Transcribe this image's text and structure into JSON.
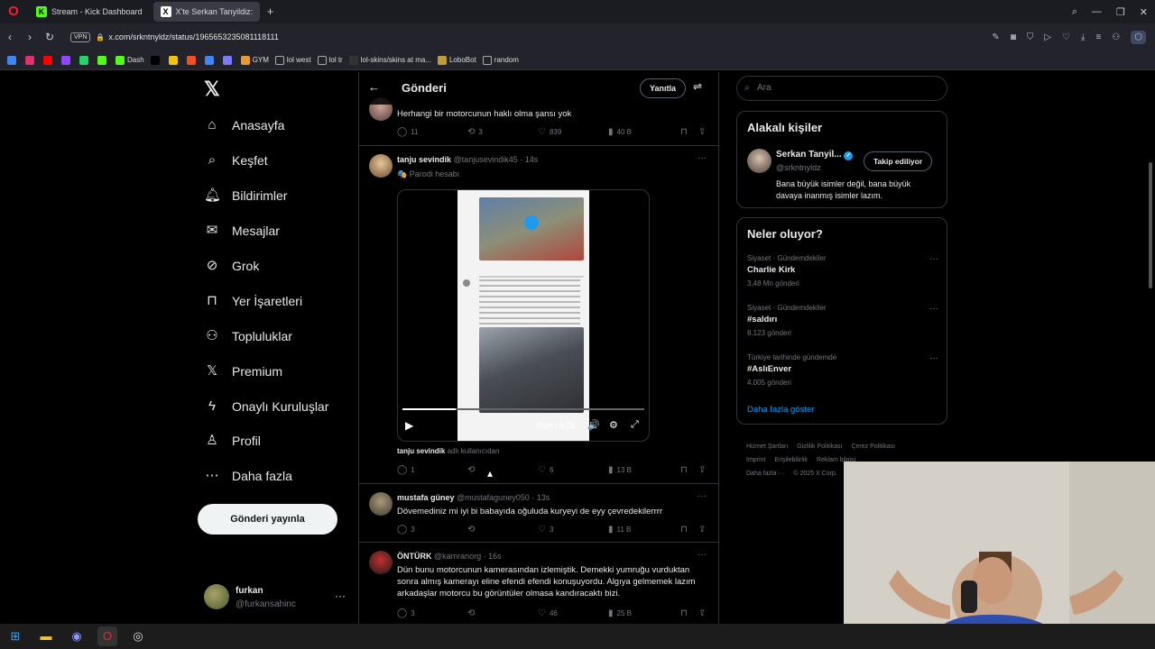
{
  "browser": {
    "tabs": [
      {
        "label": "Stream - Kick Dashboard",
        "active": false
      },
      {
        "label": "X'te Serkan Tanyildiz:",
        "active": true
      }
    ],
    "url": "x.com/srkntnyldz/status/1965653235081118111",
    "vpn_label": "VPN",
    "bookmarks": [
      {
        "label": "",
        "icon": "chrome"
      },
      {
        "label": "",
        "icon": "instagram"
      },
      {
        "label": "",
        "icon": "youtube"
      },
      {
        "label": "",
        "icon": "twitch"
      },
      {
        "label": "",
        "icon": "whatsapp"
      },
      {
        "label": "",
        "icon": "kick"
      },
      {
        "label": "Dash",
        "icon": "kick"
      },
      {
        "label": "",
        "icon": "x"
      },
      {
        "label": "",
        "icon": "s"
      },
      {
        "label": "",
        "icon": "microsoft"
      },
      {
        "label": "",
        "icon": "chrome"
      },
      {
        "label": "",
        "icon": "news"
      },
      {
        "label": "GYM",
        "icon": "gym"
      },
      {
        "label": "lol west",
        "icon": "folder"
      },
      {
        "label": "lol tr",
        "icon": "folder"
      },
      {
        "label": "lol-skins/skins at ma...",
        "icon": "github"
      },
      {
        "label": "LoboBot",
        "icon": "lobo"
      },
      {
        "label": "random",
        "icon": "folder"
      }
    ]
  },
  "nav": {
    "items": [
      {
        "label": "Anasayfa",
        "icon": "home"
      },
      {
        "label": "Keşfet",
        "icon": "search"
      },
      {
        "label": "Bildirimler",
        "icon": "bell"
      },
      {
        "label": "Mesajlar",
        "icon": "mail"
      },
      {
        "label": "Grok",
        "icon": "grok"
      },
      {
        "label": "Yer İşaretleri",
        "icon": "bookmark"
      },
      {
        "label": "Topluluklar",
        "icon": "communities"
      },
      {
        "label": "Premium",
        "icon": "x"
      },
      {
        "label": "Onaylı Kuruluşlar",
        "icon": "bolt"
      },
      {
        "label": "Profil",
        "icon": "person"
      },
      {
        "label": "Daha fazla",
        "icon": "more"
      }
    ],
    "post_button": "Gönderi yayınla",
    "account": {
      "name": "furkan",
      "handle": "@furkansahinc"
    }
  },
  "center": {
    "title": "Gönderi",
    "reply_button": "Yanıtla",
    "tweets": [
      {
        "text": "Herhangi bir motorcunun haklı olma şansı yok",
        "replies": "11",
        "retweets": "3",
        "likes": "839",
        "views": "40 B"
      },
      {
        "name": "tanju sevindik",
        "handle": "@tanjusevindik45 · 14s",
        "parody": "Parodi hesabı",
        "video_time": "0:06 / 0:28",
        "video_progress": 0.22,
        "caption_user": "tanju sevindik",
        "caption_rest": "adlı kullanıcıdan",
        "replies": "1",
        "retweets": "",
        "likes": "6",
        "views": "13 B"
      },
      {
        "name": "mustafa güney",
        "handle": "@mustafaguney050 · 13s",
        "text": "Dövemediniz mi iyi bi babayıda oğuluda kuryeyi de eyy çevredekilerrrr",
        "replies": "3",
        "retweets": "",
        "likes": "3",
        "views": "11 B"
      },
      {
        "name": "ÖNTÜRK",
        "handle": "@kamranorg · 16s",
        "text": "Dün bunu motorcunun kamerasından izlemiştik. Demekki yumruğu vurduktan sonra almış kamerayı eline efendi efendi konuşuyordu. Algıya gelmemek lazım arkadaşlar motorcu bu görüntüler olmasa kandıracaktı bizi.",
        "replies": "3",
        "retweets": "",
        "likes": "46",
        "views": "25 B"
      }
    ]
  },
  "right": {
    "search_placeholder": "Ara",
    "related": {
      "title": "Alakalı kişiler",
      "name": "Serkan Tanyil...",
      "handle": "@srkntnyldz",
      "follow_button": "Takip ediliyor",
      "bio": "Bana büyük isimler değil, bana büyük davaya inanmış isimler lazım."
    },
    "trends": {
      "title": "Neler oluyor?",
      "items": [
        {
          "category": "Siyaset · Gündemdekiler",
          "topic": "Charlie Kirk",
          "count": "3,48 Mn gönderi"
        },
        {
          "category": "Siyaset · Gündemdekiler",
          "topic": "#saldırı",
          "count": "8.123 gönderi"
        },
        {
          "category": "Türkiye tarihinde gündemde",
          "topic": "#AslıEnver",
          "count": "4.005 gönderi"
        }
      ],
      "show_more": "Daha fazla göster"
    },
    "footer": {
      "line1": [
        "Hizmet Şartları",
        "Gizlilik Politikası",
        "Çerez Politikası"
      ],
      "line2": [
        "Imprint",
        "Erişilebilirlik",
        "Reklam bilgisi"
      ],
      "line3": [
        "Daha fazla ···",
        "© 2025 X Corp."
      ]
    }
  },
  "colors": {
    "accent": "#1d9bf0",
    "bg": "#000000",
    "muted": "#71767b",
    "border": "#2f3336"
  }
}
